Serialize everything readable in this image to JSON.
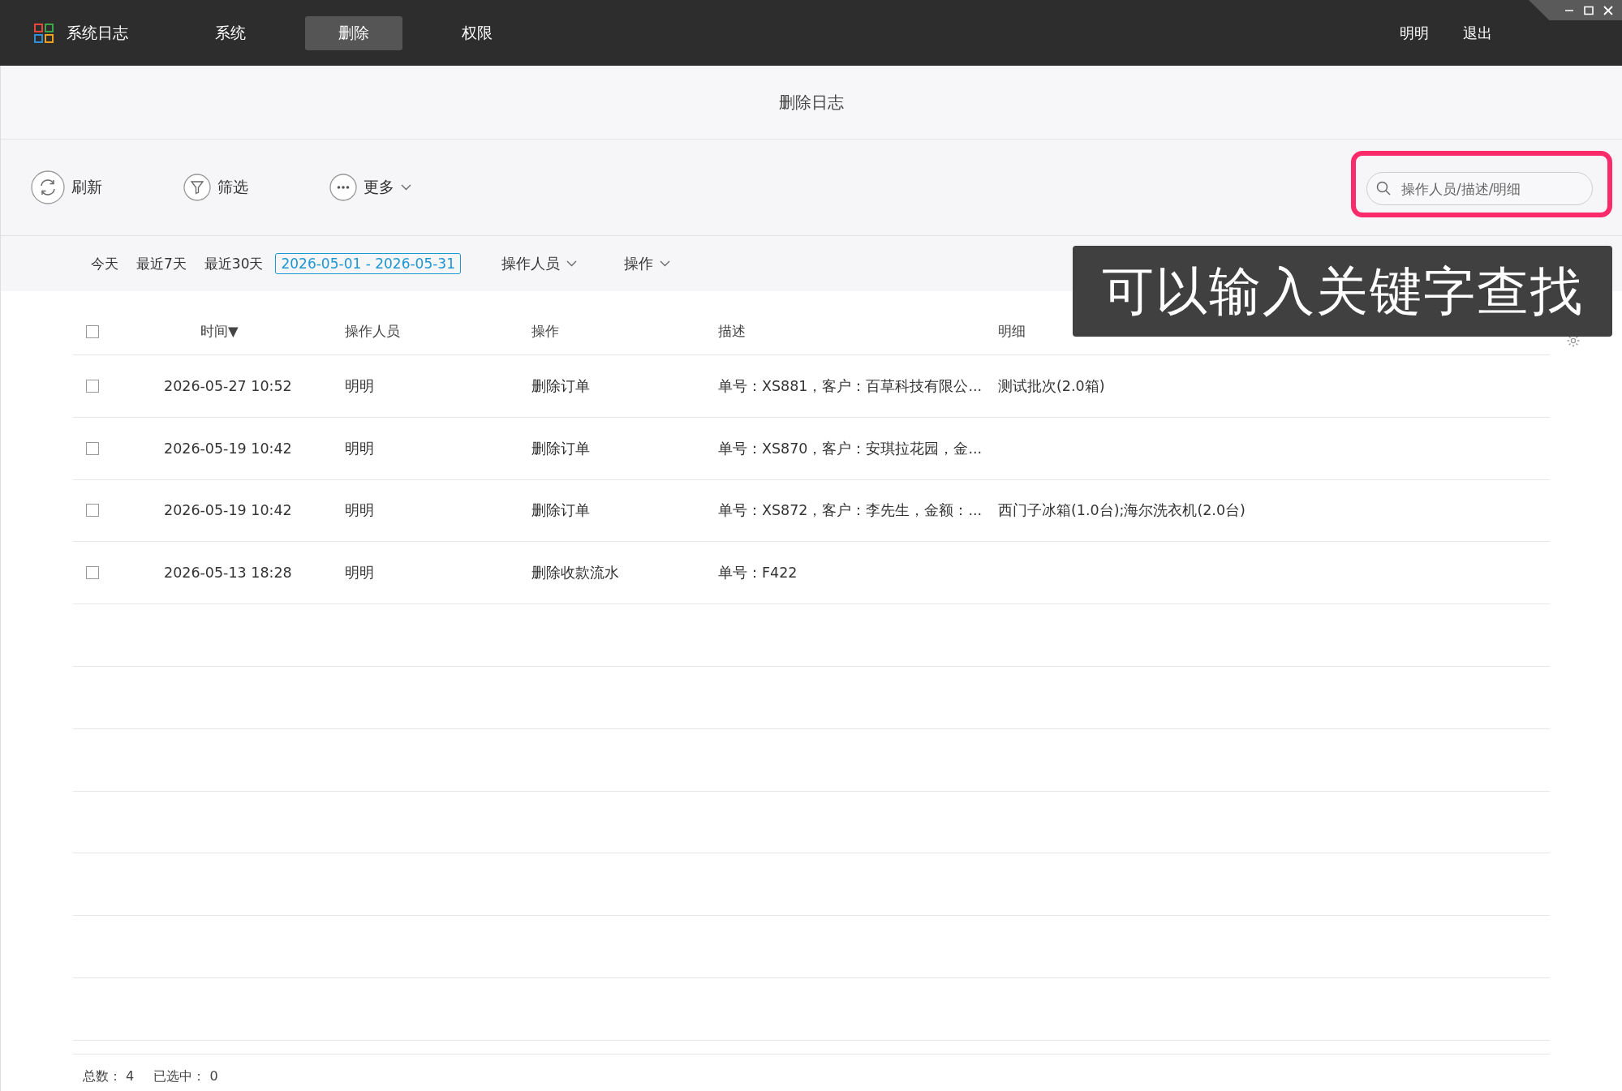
{
  "app": {
    "title": "系统日志"
  },
  "nav": [
    {
      "label": "系统",
      "selected": false
    },
    {
      "label": "删除",
      "selected": true
    },
    {
      "label": "权限",
      "selected": false
    }
  ],
  "user": {
    "name": "明明",
    "logout": "退出"
  },
  "page_title": "删除日志",
  "toolbar": [
    {
      "kind": "refresh",
      "label": "刷新"
    },
    {
      "kind": "filter",
      "label": "筛选"
    },
    {
      "kind": "more",
      "label": "更多"
    }
  ],
  "search": {
    "placeholder": "操作人员/描述/明细",
    "highlighted": true
  },
  "quick_dates": [
    {
      "label": "今天",
      "selected": false
    },
    {
      "label": "最近7天",
      "selected": false
    },
    {
      "label": "最近30天",
      "selected": false
    },
    {
      "label": "2026-05-01 - 2026-05-31",
      "selected": true
    }
  ],
  "dropdowns": [
    "操作人员",
    "操作"
  ],
  "callout": "可以输入关键字查找",
  "table": {
    "all_checked": false,
    "columns": [
      "时间▼",
      "操作人员",
      "操作",
      "描述",
      "明细"
    ],
    "rows": [
      {
        "checked": false,
        "cells": [
          "2026-05-27 10:52",
          "明明",
          "删除订单",
          "单号：XS881，客户：百草科技有限公...",
          "测试批次(2.0箱)"
        ]
      },
      {
        "checked": false,
        "cells": [
          "2026-05-19 10:42",
          "明明",
          "删除订单",
          "单号：XS870，客户：安琪拉花园，金...",
          ""
        ]
      },
      {
        "checked": false,
        "cells": [
          "2026-05-19 10:42",
          "明明",
          "删除订单",
          "单号：XS872，客户：李先生，金额：...",
          "西门子冰箱(1.0台);海尔洗衣机(2.0台)"
        ]
      },
      {
        "checked": false,
        "cells": [
          "2026-05-13 18:28",
          "明明",
          "删除收款流水",
          "单号：F422",
          ""
        ]
      }
    ]
  },
  "footer": {
    "total_label": "总数：",
    "total": "4",
    "selected_label": "已选中：",
    "selected_count": "0"
  }
}
